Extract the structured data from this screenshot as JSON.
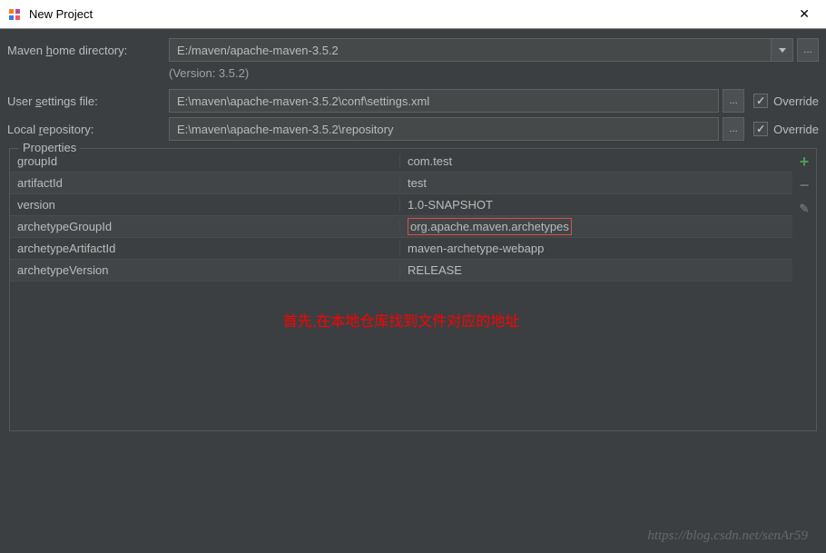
{
  "window": {
    "title": "New Project",
    "close_glyph": "✕"
  },
  "form": {
    "home_dir_label_pre": "Maven ",
    "home_dir_label_u": "h",
    "home_dir_label_post": "ome directory:",
    "home_dir_value": "E:/maven/apache-maven-3.5.2",
    "version_text": "(Version: 3.5.2)",
    "settings_label_pre": "User ",
    "settings_label_u": "s",
    "settings_label_post": "ettings file:",
    "settings_value": "E:\\maven\\apache-maven-3.5.2\\conf\\settings.xml",
    "repo_label_pre": "Local ",
    "repo_label_u": "r",
    "repo_label_post": "epository:",
    "repo_value": "E:\\maven\\apache-maven-3.5.2\\repository",
    "override_label": "Override",
    "ellipsis": "..."
  },
  "properties": {
    "legend": "Properties",
    "rows": [
      {
        "key": "groupId",
        "val": "com.test"
      },
      {
        "key": "artifactId",
        "val": "test"
      },
      {
        "key": "version",
        "val": "1.0-SNAPSHOT"
      },
      {
        "key": "archetypeGroupId",
        "val": "org.apache.maven.archetypes"
      },
      {
        "key": "archetypeArtifactId",
        "val": "maven-archetype-webapp"
      },
      {
        "key": "archetypeVersion",
        "val": "RELEASE"
      }
    ],
    "annotation": "首先,在本地仓库找到文件对应的地址",
    "add_glyph": "+",
    "remove_glyph": "−",
    "edit_glyph": "✎"
  },
  "watermark": "https://blog.csdn.net/senAr59"
}
